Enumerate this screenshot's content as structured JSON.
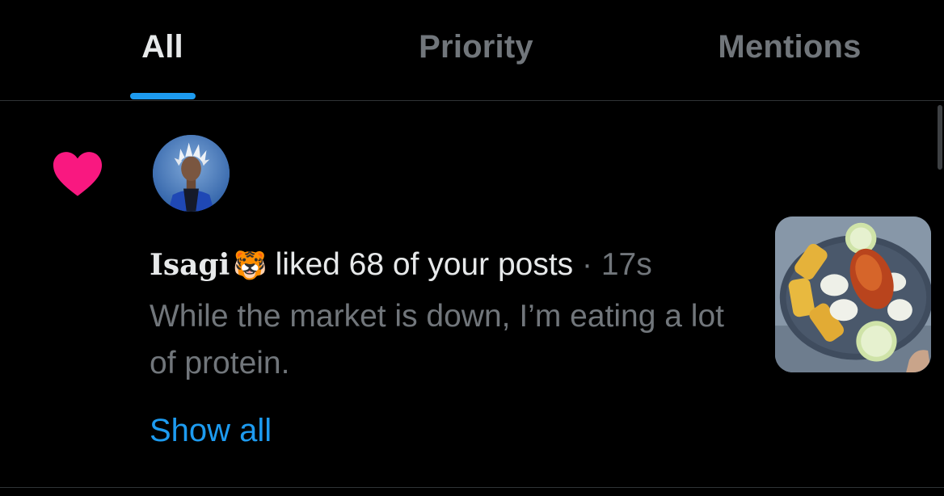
{
  "tabs": [
    {
      "label": "All",
      "active": true
    },
    {
      "label": "Priority",
      "active": false
    },
    {
      "label": "Mentions",
      "active": false
    }
  ],
  "notification": {
    "type_icon": "heart-icon",
    "type_color": "#f91880",
    "avatar": "user-avatar",
    "user_name": "Isagi",
    "user_emoji": "🐯",
    "action": "liked 68 of your posts",
    "separator": "·",
    "time": "17s",
    "post_text": "While the market is down, I’m eating a lot of protein.",
    "show_all_label": "Show all",
    "media": "food-plate-thumbnail"
  },
  "colors": {
    "background": "#000000",
    "accent": "#1d9bf0",
    "primary_text": "#e7e9ea",
    "secondary_text": "#71767b",
    "divider": "#2f3336",
    "like": "#f91880"
  }
}
